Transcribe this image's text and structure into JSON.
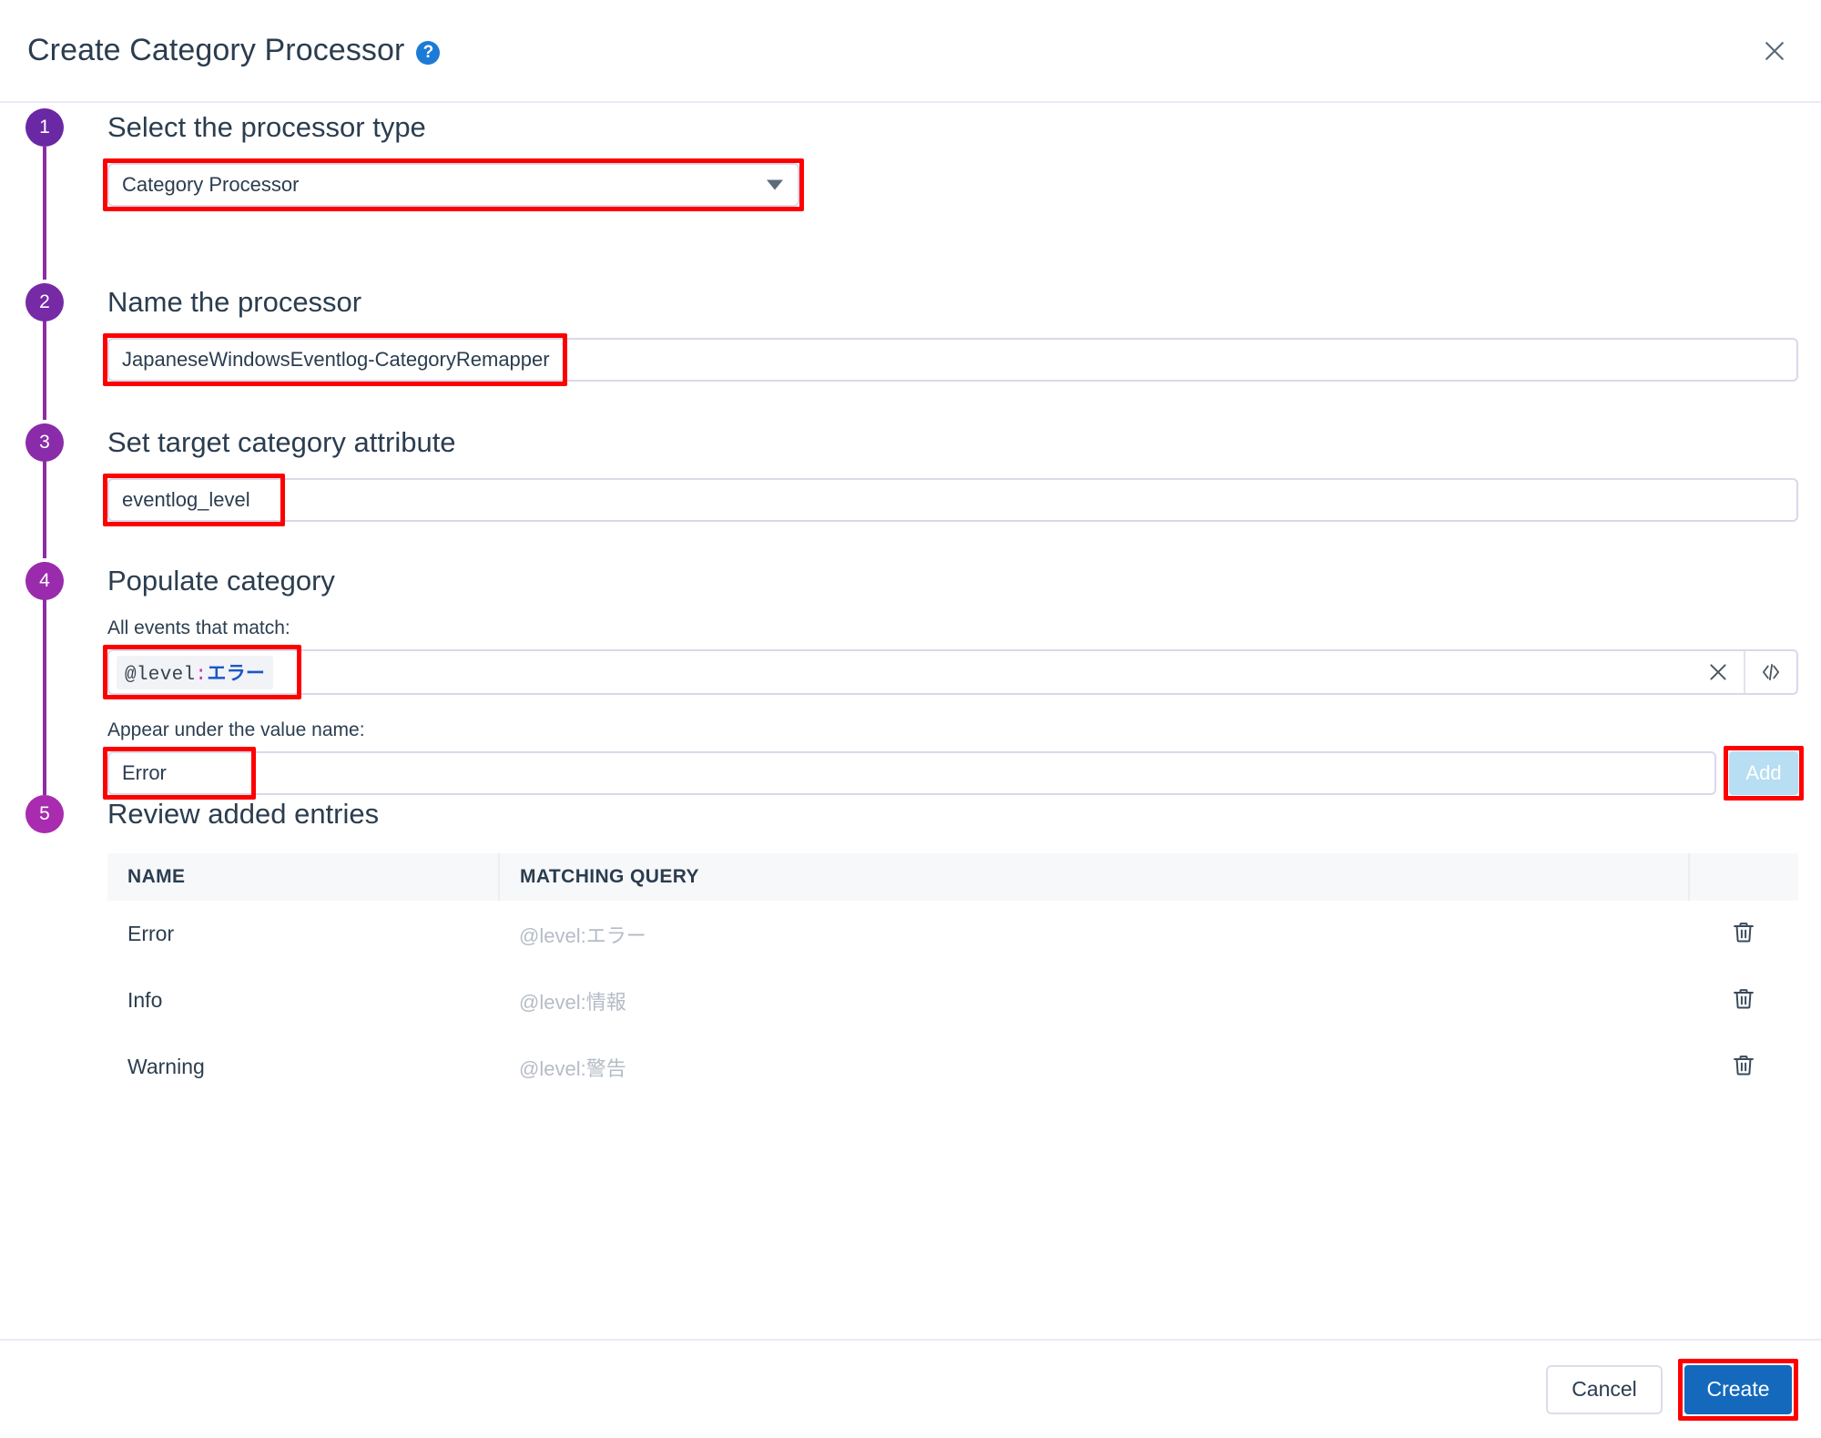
{
  "dialog": {
    "title": "Create Category Processor",
    "help_icon": "help-circle-icon",
    "close_icon": "close-icon"
  },
  "steps": [
    {
      "number": "1",
      "title": "Select the processor type",
      "color": "#6a28a4"
    },
    {
      "number": "2",
      "title": "Name the processor",
      "color": "#762aa6"
    },
    {
      "number": "3",
      "title": "Set target category attribute",
      "color": "#8a2baa"
    },
    {
      "number": "4",
      "title": "Populate category",
      "color": "#9a2bad"
    },
    {
      "number": "5",
      "title": "Review added entries",
      "color": "#a82bb0"
    }
  ],
  "processor_type": {
    "value": "Category Processor",
    "caret_icon": "chevron-down-icon"
  },
  "processor_name": {
    "value": "JapaneseWindowsEventlog-CategoryRemapper",
    "placeholder": ""
  },
  "target_attribute": {
    "value": "eventlog_level",
    "placeholder": ""
  },
  "populate": {
    "match_label": "All events that match:",
    "query": {
      "field": "@level",
      "colon": ":",
      "value": "エラー",
      "full": "@level:エラー"
    },
    "clear_icon": "close-icon",
    "code_icon": "code-brackets-icon",
    "value_name_label": "Appear under the value name:",
    "value_name": "Error",
    "add_label": "Add"
  },
  "entries_table": {
    "columns": [
      "NAME",
      "MATCHING QUERY",
      ""
    ],
    "rows": [
      {
        "name": "Error",
        "query": "@level:エラー",
        "delete_icon": "trash-icon"
      },
      {
        "name": "Info",
        "query": "@level:情報",
        "delete_icon": "trash-icon"
      },
      {
        "name": "Warning",
        "query": "@level:警告",
        "delete_icon": "trash-icon"
      }
    ]
  },
  "footer": {
    "cancel_label": "Cancel",
    "create_label": "Create"
  },
  "colors": {
    "step_purple": "#8e2ca6",
    "primary_blue": "#1469bd",
    "add_disabled": "#b7def2",
    "annotation_red": "#ff0000",
    "help_blue": "#1b7bd6"
  }
}
